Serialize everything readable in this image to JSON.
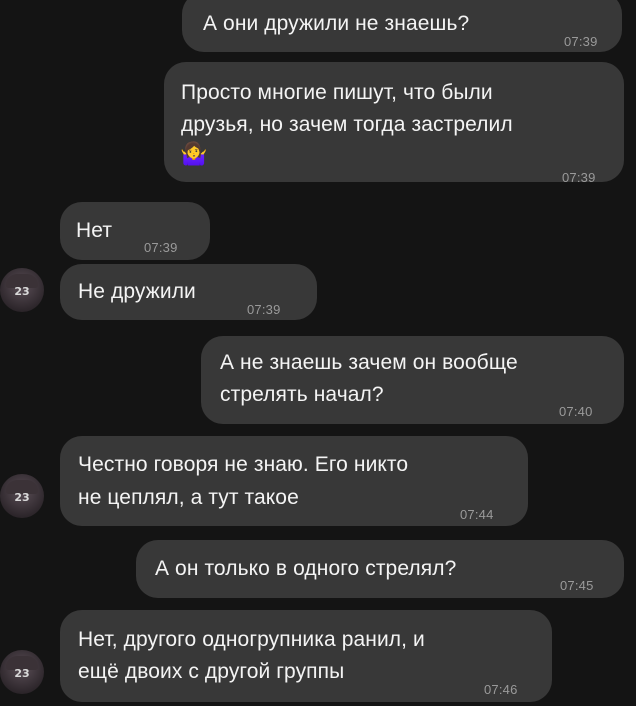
{
  "messages": [
    {
      "side": "right",
      "lines": [
        "А они дружили не знаешь?"
      ],
      "time": "07:39"
    },
    {
      "side": "right",
      "lines": [
        "Просто многие пишут, что были",
        "друзья, но зачем тогда застрелил"
      ],
      "emoji": "🤷‍♀️",
      "time": "07:39"
    },
    {
      "side": "left",
      "lines": [
        "Нет"
      ],
      "time": "07:39"
    },
    {
      "side": "left",
      "lines": [
        "Не дружили"
      ],
      "time": "07:39"
    },
    {
      "side": "right",
      "lines": [
        "А не знаешь зачем он вообще",
        "стрелять начал?"
      ],
      "time": "07:40"
    },
    {
      "side": "left",
      "lines": [
        "Честно говоря не знаю. Его никто",
        "не цеплял, а тут такое"
      ],
      "time": "07:44"
    },
    {
      "side": "right",
      "lines": [
        "А он только в одного стрелял?"
      ],
      "time": "07:45"
    },
    {
      "side": "left",
      "lines": [
        "Нет, другого одногрупника ранил, и",
        "ещё двоих с другой группы"
      ],
      "time": "07:46"
    }
  ],
  "avatar_icon": "user-avatar-icon",
  "emoji_icon": "woman-shrugging-icon"
}
